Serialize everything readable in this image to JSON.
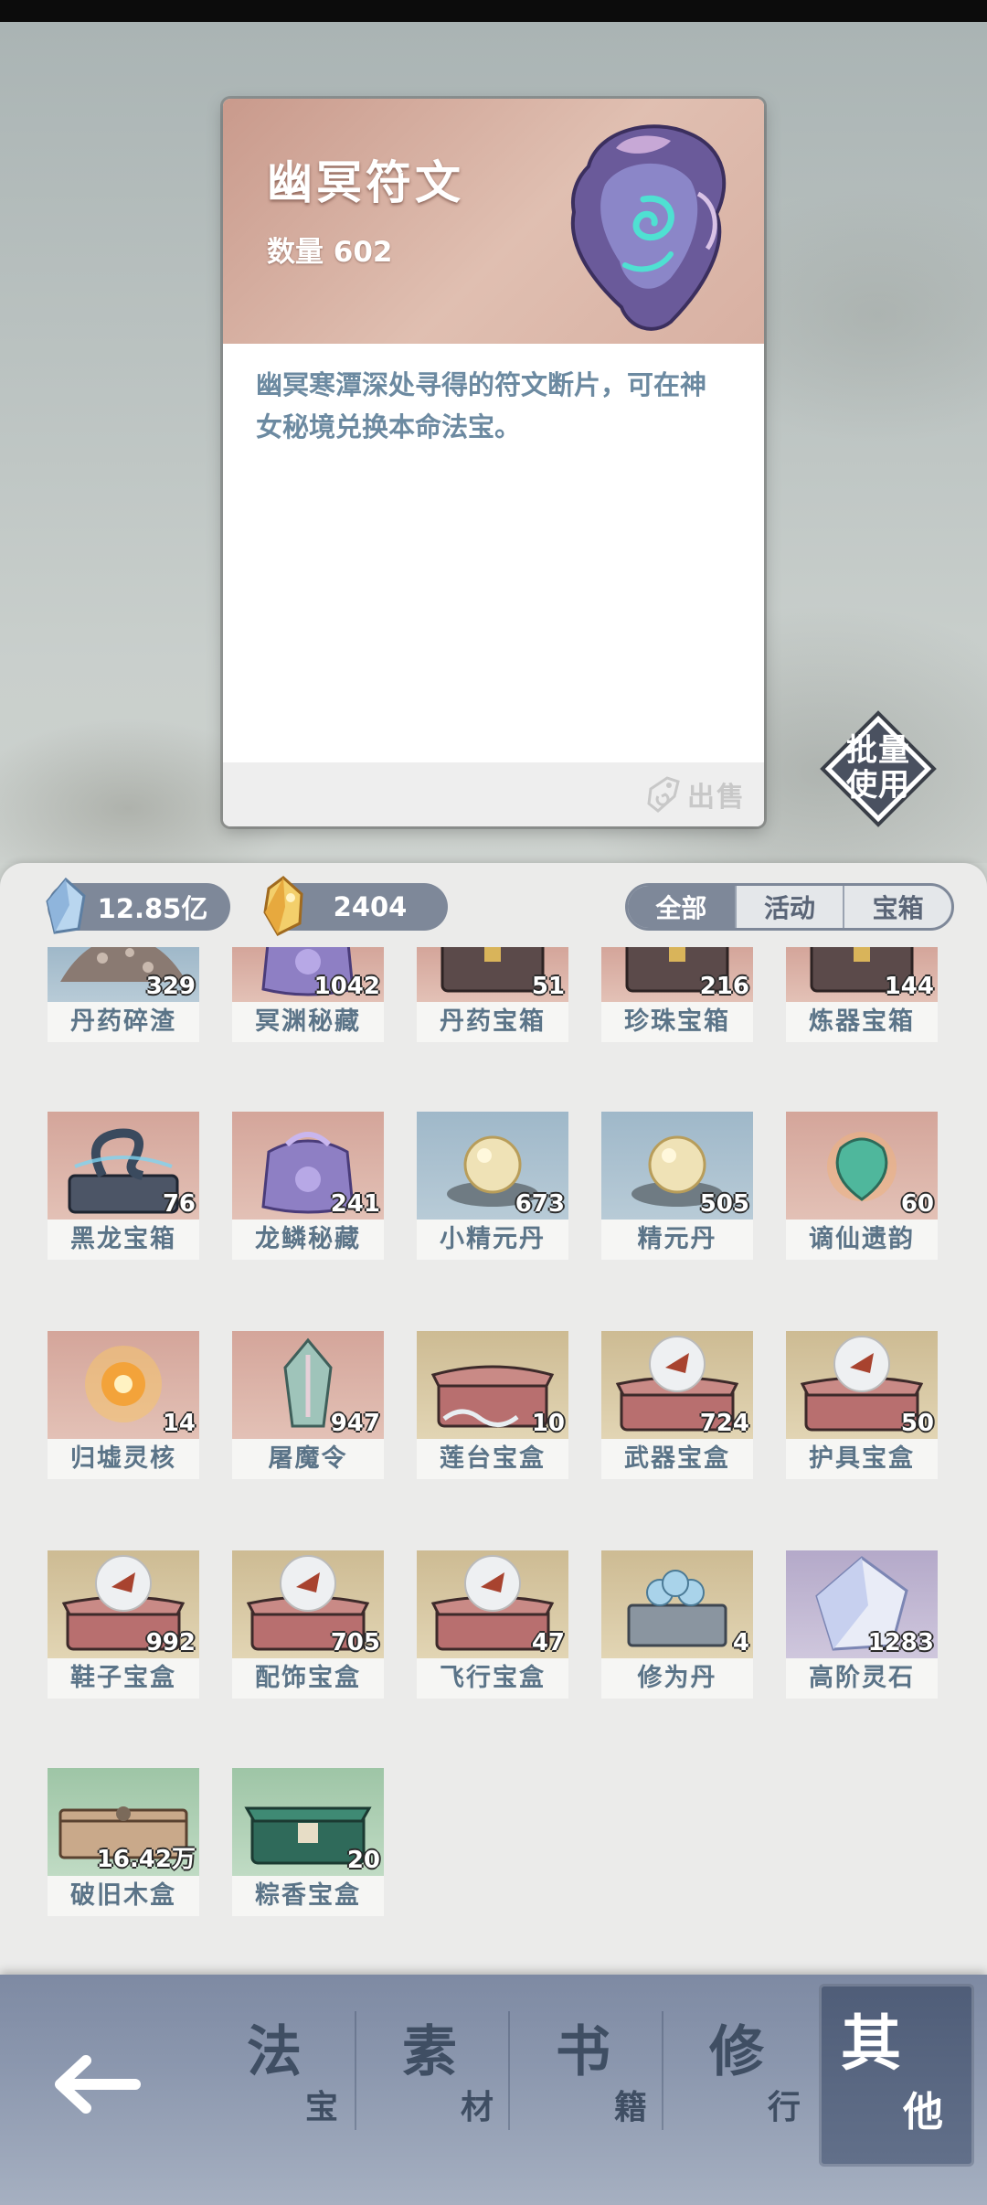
{
  "detail": {
    "title": "幽冥符文",
    "quantity": "数量 602",
    "description": "幽冥寒潭深处寻得的符文断片，可在神女秘境兑换本命法宝。",
    "sell_label": "出售"
  },
  "batch_use": {
    "line1": "批量",
    "line2": "使用"
  },
  "currency": {
    "spirit_stone": "12.85亿",
    "gold_jade": "2404"
  },
  "filters": [
    {
      "label": "全部",
      "active": true
    },
    {
      "label": "活动",
      "active": false
    },
    {
      "label": "宝箱",
      "active": false
    }
  ],
  "items": [
    {
      "name": "丹药碎渣",
      "count": "329",
      "quality": "q-blue",
      "icon": "pill-debris-icon"
    },
    {
      "name": "冥渊秘藏",
      "count": "1042",
      "quality": "q-pink",
      "icon": "treasure-bag-icon"
    },
    {
      "name": "丹药宝箱",
      "count": "51",
      "quality": "q-pink",
      "icon": "pill-chest-icon"
    },
    {
      "name": "珍珠宝箱",
      "count": "216",
      "quality": "q-pink",
      "icon": "pearl-chest-icon"
    },
    {
      "name": "炼器宝箱",
      "count": "144",
      "quality": "q-pink",
      "icon": "forge-chest-icon"
    },
    {
      "name": "黑龙宝箱",
      "count": "76",
      "quality": "q-pink",
      "icon": "black-dragon-chest-icon"
    },
    {
      "name": "龙鳞秘藏",
      "count": "241",
      "quality": "q-pink",
      "icon": "dragon-scale-bag-icon"
    },
    {
      "name": "小精元丹",
      "count": "673",
      "quality": "q-blue",
      "icon": "small-pill-icon"
    },
    {
      "name": "精元丹",
      "count": "505",
      "quality": "q-blue",
      "icon": "pill-icon"
    },
    {
      "name": "谪仙遗韵",
      "count": "60",
      "quality": "q-pink",
      "icon": "immortal-relic-icon"
    },
    {
      "name": "归墟灵核",
      "count": "14",
      "quality": "q-pink",
      "icon": "spirit-core-icon"
    },
    {
      "name": "屠魔令",
      "count": "947",
      "quality": "q-pink",
      "icon": "demon-slayer-token-icon"
    },
    {
      "name": "莲台宝盒",
      "count": "10",
      "quality": "q-gold",
      "icon": "lotus-box-icon"
    },
    {
      "name": "武器宝盒",
      "count": "724",
      "quality": "q-gold",
      "icon": "weapon-box-icon"
    },
    {
      "name": "护具宝盒",
      "count": "50",
      "quality": "q-gold",
      "icon": "armor-box-icon"
    },
    {
      "name": "鞋子宝盒",
      "count": "992",
      "quality": "q-gold",
      "icon": "shoe-box-icon"
    },
    {
      "name": "配饰宝盒",
      "count": "705",
      "quality": "q-gold",
      "icon": "accessory-box-icon"
    },
    {
      "name": "飞行宝盒",
      "count": "47",
      "quality": "q-gold",
      "icon": "flight-box-icon"
    },
    {
      "name": "修为丹",
      "count": "4",
      "quality": "q-gold",
      "icon": "cultivation-pill-icon"
    },
    {
      "name": "高阶灵石",
      "count": "1283",
      "quality": "q-purple",
      "icon": "high-spirit-stone-icon"
    },
    {
      "name": "破旧木盒",
      "count": "16.42万",
      "quality": "q-green",
      "icon": "old-wooden-box-icon"
    },
    {
      "name": "粽香宝盒",
      "count": "20",
      "quality": "q-green",
      "icon": "zongzi-box-icon"
    }
  ],
  "nav": [
    {
      "big": "法",
      "small": "宝",
      "active": false
    },
    {
      "big": "素",
      "small": "材",
      "active": false
    },
    {
      "big": "书",
      "small": "籍",
      "active": false
    },
    {
      "big": "修",
      "small": "行",
      "active": false
    },
    {
      "big": "其",
      "small": "他",
      "active": true
    }
  ],
  "colors": {
    "label_text": "#5b7488",
    "currency_pill": "#7e8899",
    "nav_bar": "#8b97ae"
  }
}
